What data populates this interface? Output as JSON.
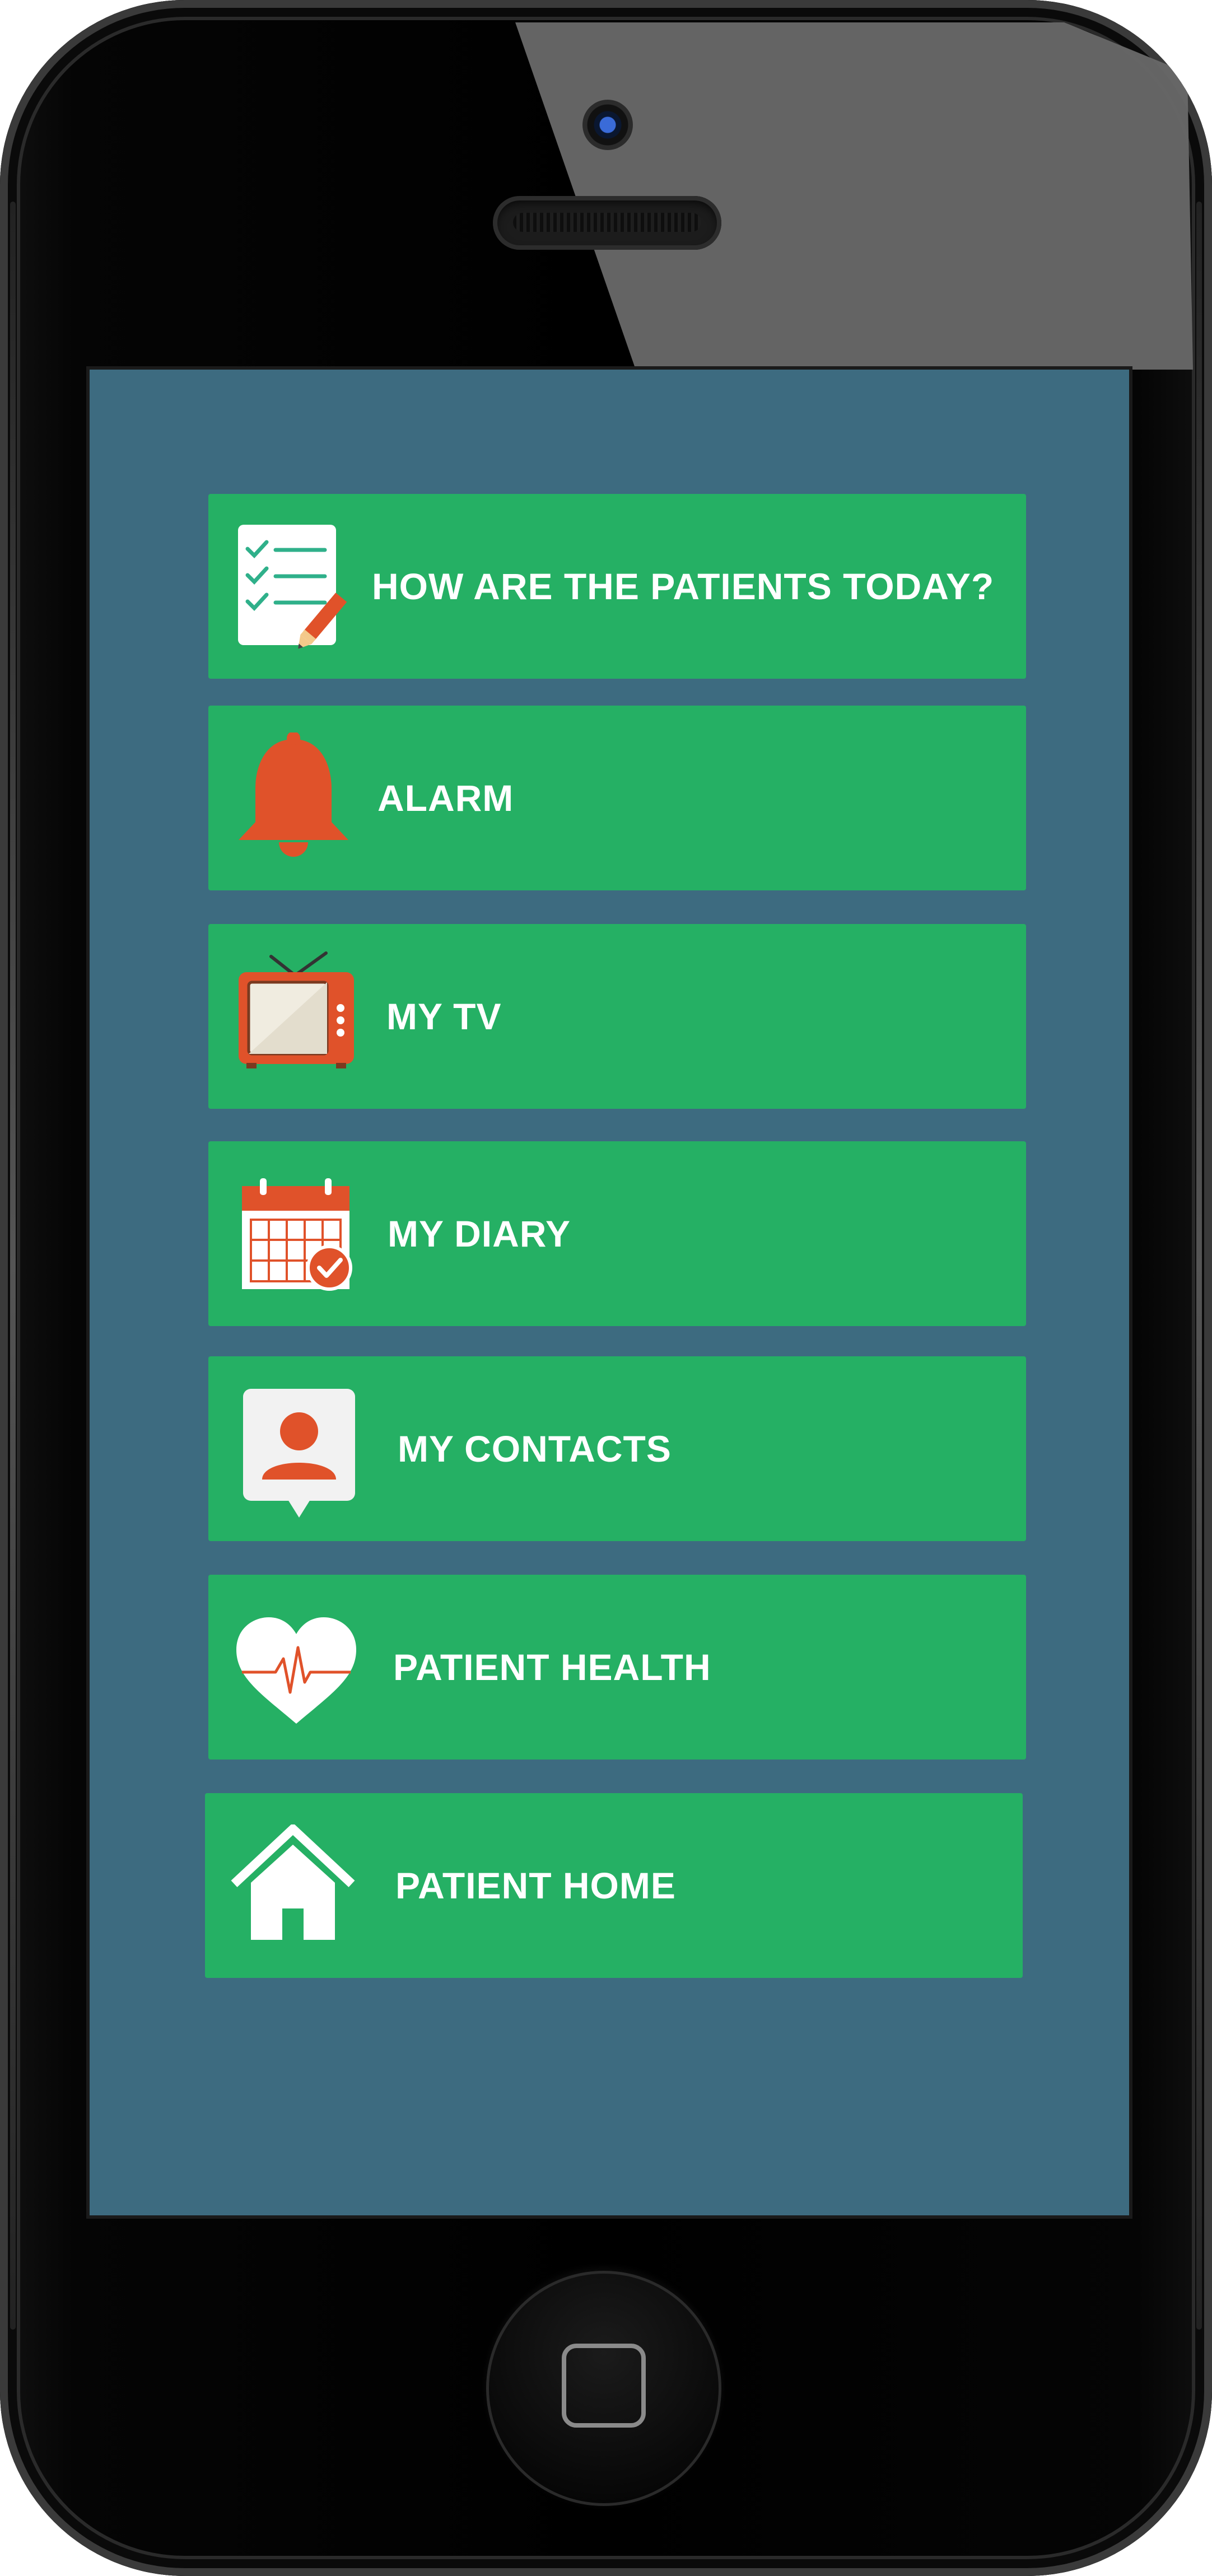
{
  "app": {
    "menu_items": [
      {
        "label": "HOW ARE THE PATIENTS TODAY?",
        "icon": "checklist-pencil-icon"
      },
      {
        "label": "ALARM",
        "icon": "bell-icon"
      },
      {
        "label": "MY TV",
        "icon": "tv-icon"
      },
      {
        "label": "MY DIARY",
        "icon": "calendar-icon"
      },
      {
        "label": "MY CONTACTS",
        "icon": "contact-person-icon"
      },
      {
        "label": "PATIENT HEALTH",
        "icon": "heart-pulse-icon"
      },
      {
        "label": "PATIENT HOME",
        "icon": "house-icon"
      }
    ]
  },
  "colors": {
    "screen_background": "#3d6b80",
    "menu_button": "#25b064",
    "icon_accent": "#e0522a",
    "label_text": "#ffffff"
  }
}
